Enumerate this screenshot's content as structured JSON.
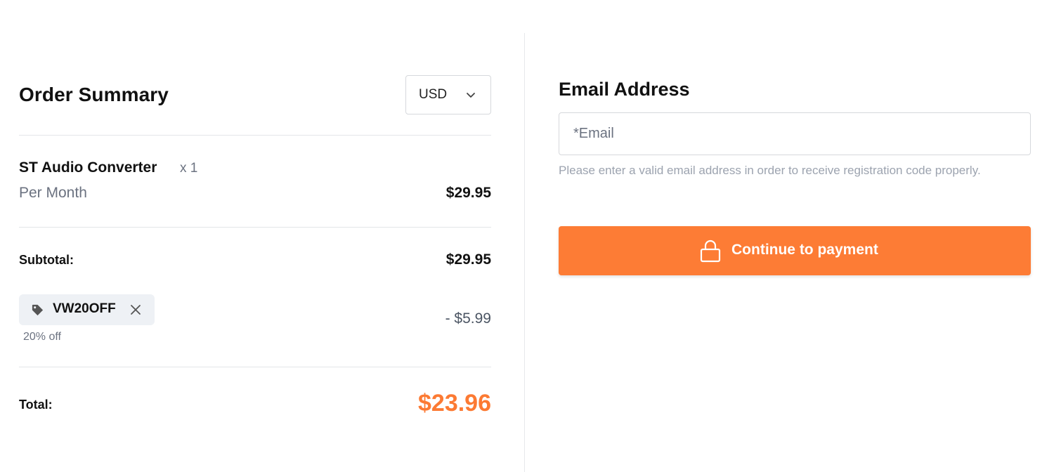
{
  "order_summary": {
    "title": "Order Summary",
    "currency": {
      "selected": "USD"
    },
    "item": {
      "name": "ST Audio Converter",
      "quantity": "x 1",
      "period": "Per Month",
      "price": "$29.95"
    },
    "subtotal": {
      "label": "Subtotal:",
      "value": "$29.95"
    },
    "coupon": {
      "code": "VW20OFF",
      "note": "20% off",
      "discount": "- $5.99"
    },
    "total": {
      "label": "Total:",
      "value": "$23.96"
    }
  },
  "email_section": {
    "heading": "Email Address",
    "placeholder": "*Email",
    "value": "",
    "help_text": "Please enter a valid email address in order to receive registration code properly."
  },
  "payment_button": {
    "label": "Continue to payment"
  },
  "colors": {
    "accent": "#fd7c35",
    "total_text": "#fc7a33",
    "muted_text": "#6b7280",
    "help_text": "#9ca3af",
    "chip_background": "#eef1f5"
  },
  "icons": {
    "currency_dropdown": "chevron-down-icon",
    "coupon_tag": "tag-icon",
    "coupon_remove": "close-icon",
    "payment": "lock-icon"
  }
}
